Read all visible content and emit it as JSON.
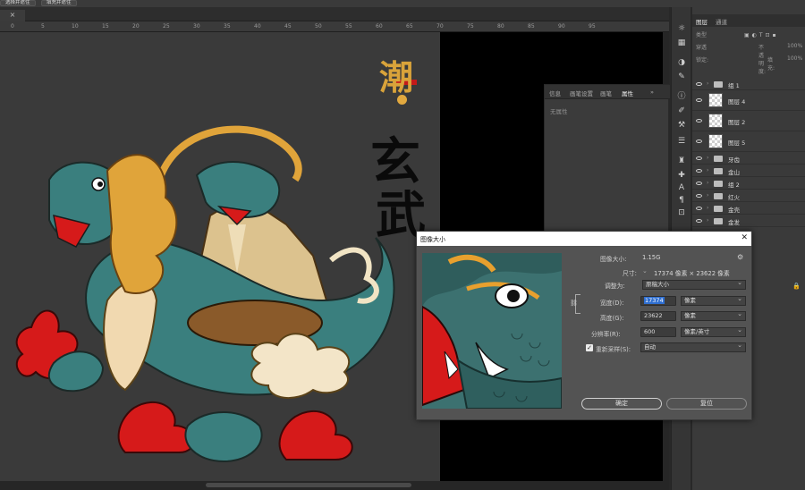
{
  "options_bar": {
    "btn1": "选择并遮住",
    "btn2": "填充并遮住"
  },
  "document": {
    "tab_close": "×"
  },
  "ruler": {
    "ticks": [
      "0",
      "5",
      "10",
      "15",
      "20",
      "25",
      "30",
      "35",
      "40",
      "45",
      "50",
      "55",
      "60",
      "65",
      "70",
      "75",
      "80",
      "85",
      "90",
      "95"
    ]
  },
  "artwork": {
    "char1": "潮",
    "char2": "玄",
    "char3": "武"
  },
  "properties_panel": {
    "tabs": [
      "信息",
      "画笔设置",
      "画笔",
      "属性"
    ],
    "active_tab": "属性",
    "collapse": "»",
    "empty_text": "无属性"
  },
  "layers_panel": {
    "tabs": [
      "图层",
      "通道"
    ],
    "filter_placeholder": "类型",
    "blend_mode": "穿透",
    "opacity_label": "不透明度:",
    "opacity_value": "100%",
    "lock_label": "锁定:",
    "fill_label": "填充:",
    "fill_value": "100%",
    "layers": [
      {
        "name": "组 1",
        "type": "group"
      },
      {
        "name": "图层 4",
        "type": "layer"
      },
      {
        "name": "图层 2",
        "type": "layer"
      },
      {
        "name": "图层 5",
        "type": "layer"
      },
      {
        "name": "牙齿",
        "type": "group"
      },
      {
        "name": "金山",
        "type": "group"
      },
      {
        "name": "组 2",
        "type": "group"
      },
      {
        "name": "红火",
        "type": "group"
      },
      {
        "name": "金壳",
        "type": "group"
      },
      {
        "name": "金发",
        "type": "group"
      }
    ]
  },
  "dialog": {
    "title": "图像大小",
    "close": "✕",
    "image_size_label": "图像大小:",
    "image_size_value": "1.15G",
    "dimensions_label": "尺寸:",
    "dimensions_value": "17374 像素 × 23622 像素",
    "fit_to_label": "调整为:",
    "fit_to_value": "原稿大小",
    "width_label": "宽度(D):",
    "width_value": "17374",
    "width_unit": "像素",
    "height_label": "高度(G):",
    "height_value": "23622",
    "height_unit": "像素",
    "resolution_label": "分辨率(R):",
    "resolution_value": "600",
    "resolution_unit": "像素/英寸",
    "resample_label": "重新采样(S):",
    "resample_checked": "✓",
    "resample_value": "自动",
    "ok_label": "确定",
    "reset_label": "复位"
  },
  "colors": {
    "teal": "#3a7f7e",
    "gold": "#e0a43a",
    "red": "#d61a1a",
    "cream": "#f1d9b0"
  }
}
